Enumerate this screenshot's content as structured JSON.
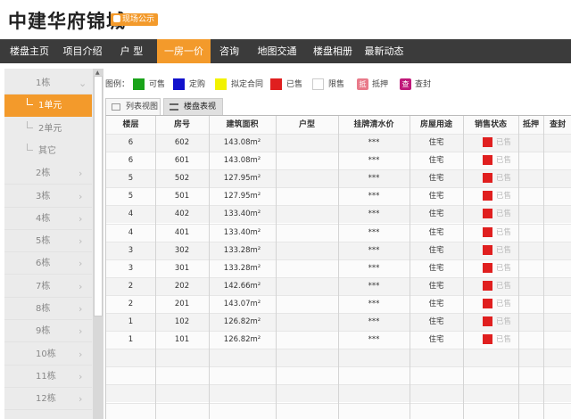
{
  "header": {
    "title": "中建华府锦城",
    "badge": "现场公示"
  },
  "nav": [
    "楼盘主页",
    "项目介绍",
    "户 型",
    "一房一价",
    "咨询",
    "地图交通",
    "楼盘相册",
    "最新动态"
  ],
  "nav_active_index": 3,
  "sidebar": {
    "items": [
      {
        "label": "1栋",
        "type": "building",
        "chevron": "chevron-down"
      },
      {
        "label": "1单元",
        "type": "unit",
        "active": true
      },
      {
        "label": "2单元",
        "type": "unit"
      },
      {
        "label": "其它",
        "type": "unit"
      },
      {
        "label": "2栋",
        "type": "building",
        "chevron": "chevron-right"
      },
      {
        "label": "3栋",
        "type": "building",
        "chevron": "chevron-right"
      },
      {
        "label": "4栋",
        "type": "building",
        "chevron": "chevron-right"
      },
      {
        "label": "5栋",
        "type": "building",
        "chevron": "chevron-right"
      },
      {
        "label": "6栋",
        "type": "building",
        "chevron": "chevron-right"
      },
      {
        "label": "7栋",
        "type": "building",
        "chevron": "chevron-right"
      },
      {
        "label": "8栋",
        "type": "building",
        "chevron": "chevron-right"
      },
      {
        "label": "9栋",
        "type": "building",
        "chevron": "chevron-right"
      },
      {
        "label": "10栋",
        "type": "building",
        "chevron": "chevron-right"
      },
      {
        "label": "11栋",
        "type": "building",
        "chevron": "chevron-right"
      },
      {
        "label": "12栋",
        "type": "building",
        "chevron": "chevron-right"
      }
    ]
  },
  "legend": {
    "label": "图例：",
    "items": [
      {
        "label": "可售",
        "color": "#1aa31a",
        "kind": "swatch"
      },
      {
        "label": "定购",
        "color": "#1111cc",
        "kind": "swatch"
      },
      {
        "label": "拟定合同",
        "color": "#f2f200",
        "kind": "swatch"
      },
      {
        "label": "已售",
        "color": "#e01f1f",
        "kind": "swatch"
      },
      {
        "label": "限售",
        "color": "#ffffff",
        "kind": "swatch"
      },
      {
        "label": "抵押",
        "color": "#e97a8a",
        "kind": "tag",
        "tag": "抵"
      },
      {
        "label": "查封",
        "color": "#c0187a",
        "kind": "tag",
        "tag": "查"
      }
    ]
  },
  "tabs": [
    "列表视图",
    "楼盘表视图"
  ],
  "table": {
    "columns": [
      "楼层",
      "房号",
      "建筑面积",
      "户型",
      "挂牌清水价",
      "房屋用途",
      "销售状态",
      "抵押",
      "查封"
    ],
    "area_unit": "m²",
    "rows": [
      {
        "floor": "6",
        "room": "602",
        "area": "143.08",
        "type": "",
        "price": "***",
        "use": "住宅",
        "status": "已售"
      },
      {
        "floor": "6",
        "room": "601",
        "area": "143.08",
        "type": "",
        "price": "***",
        "use": "住宅",
        "status": "已售"
      },
      {
        "floor": "5",
        "room": "502",
        "area": "127.95",
        "type": "",
        "price": "***",
        "use": "住宅",
        "status": "已售"
      },
      {
        "floor": "5",
        "room": "501",
        "area": "127.95",
        "type": "",
        "price": "***",
        "use": "住宅",
        "status": "已售"
      },
      {
        "floor": "4",
        "room": "402",
        "area": "133.40",
        "type": "",
        "price": "***",
        "use": "住宅",
        "status": "已售"
      },
      {
        "floor": "4",
        "room": "401",
        "area": "133.40",
        "type": "",
        "price": "***",
        "use": "住宅",
        "status": "已售"
      },
      {
        "floor": "3",
        "room": "302",
        "area": "133.28",
        "type": "",
        "price": "***",
        "use": "住宅",
        "status": "已售"
      },
      {
        "floor": "3",
        "room": "301",
        "area": "133.28",
        "type": "",
        "price": "***",
        "use": "住宅",
        "status": "已售"
      },
      {
        "floor": "2",
        "room": "202",
        "area": "142.66",
        "type": "",
        "price": "***",
        "use": "住宅",
        "status": "已售"
      },
      {
        "floor": "2",
        "room": "201",
        "area": "143.07",
        "type": "",
        "price": "***",
        "use": "住宅",
        "status": "已售"
      },
      {
        "floor": "1",
        "room": "102",
        "area": "126.82",
        "type": "",
        "price": "***",
        "use": "住宅",
        "status": "已售"
      },
      {
        "floor": "1",
        "room": "101",
        "area": "126.82",
        "type": "",
        "price": "***",
        "use": "住宅",
        "status": "已售"
      }
    ],
    "empty_rows": 4
  }
}
